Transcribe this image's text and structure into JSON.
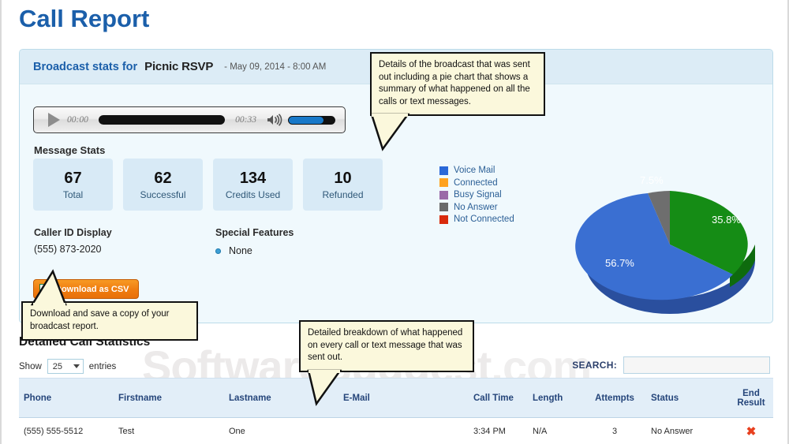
{
  "page": {
    "title": "Call Report",
    "watermark_main": "SoftwareSuggest",
    "watermark_suffix": ".com",
    "accent_color": "#1b5faa"
  },
  "panel": {
    "header_prefix": "Broadcast stats for",
    "broadcast_name": "Picnic RSVP",
    "date": "- May 09, 2014 - 8:00 AM"
  },
  "player": {
    "current_time": "00:00",
    "total_time": "00:33",
    "play_icon": "play-triangle-icon",
    "speaker_icon": "speaker-icon"
  },
  "message_stats": {
    "label": "Message Stats",
    "boxes": [
      {
        "value": "67",
        "label": "Total"
      },
      {
        "value": "62",
        "label": "Successful"
      },
      {
        "value": "134",
        "label": "Credits Used"
      },
      {
        "value": "10",
        "label": "Refunded"
      }
    ]
  },
  "caller_id": {
    "title": "Caller ID Display",
    "value": "(555) 873-2020"
  },
  "special_features": {
    "title": "Special Features",
    "value": "None"
  },
  "csv_button": {
    "label": "Download as CSV",
    "icon": "excel-file-icon",
    "glyph": "X",
    "color": "#f07e11"
  },
  "legend": {
    "items": [
      {
        "label": "Voice Mail",
        "color": "#2a68d8"
      },
      {
        "label": "Connected",
        "color": "#ffa21f"
      },
      {
        "label": "Busy Signal",
        "color": "#9a6aa8"
      },
      {
        "label": "No Answer",
        "color": "#6a6a6a"
      },
      {
        "label": "Not Connected",
        "color": "#d92b0c"
      }
    ]
  },
  "chart_data": {
    "type": "pie",
    "title": "",
    "three_d": true,
    "legend_position": "left",
    "categories": [
      "Connected",
      "Voice Mail",
      "No Answer"
    ],
    "values": [
      35.8,
      56.7,
      7.5
    ],
    "labels": [
      "35.8%",
      "56.7%",
      "7.5%"
    ],
    "colors": [
      "#158c15",
      "#3a6fd2",
      "#6e6e6e"
    ],
    "side_colors": [
      "#0e6b0e",
      "#2a4f9e",
      "#4f4f4f"
    ],
    "unit": "%"
  },
  "tooltips": {
    "broadcast": "Details of the broadcast that was sent out including a pie chart that shows a summary of what happened on all the calls or text messages.",
    "download": "Download and save a copy of your broadcast report.",
    "table": "Detailed breakdown of what happened on every call or text message that was sent out."
  },
  "detailed": {
    "title": "Detailed Call Statistics",
    "show_prefix": "Show",
    "entries_value": "25",
    "show_suffix": "entries",
    "search_label": "SEARCH:",
    "search_value": "",
    "search_placeholder": ""
  },
  "table": {
    "columns": [
      "Phone",
      "Firstname",
      "Lastname",
      "E-Mail",
      "Call Time",
      "Length",
      "Attempts",
      "Status",
      "End Result"
    ],
    "end_result_line1": "End",
    "end_result_line2": "Result",
    "rows": [
      {
        "phone": "(555) 555-5512",
        "firstname": "Test",
        "lastname": "One",
        "email": "",
        "call_time": "3:34 PM",
        "length": "N/A",
        "attempts": "3",
        "status": "No Answer",
        "end_result_icon": "red-x-icon",
        "end_result_glyph": "✖"
      }
    ]
  }
}
